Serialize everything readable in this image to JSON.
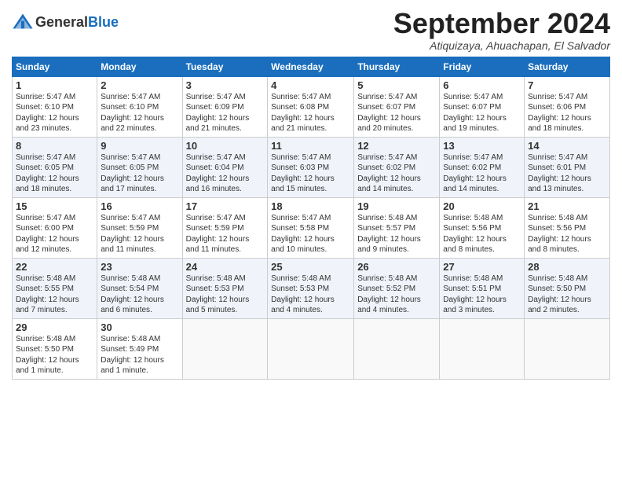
{
  "header": {
    "logo_text_general": "General",
    "logo_text_blue": "Blue",
    "month": "September 2024",
    "location": "Atiquizaya, Ahuachapan, El Salvador"
  },
  "columns": [
    "Sunday",
    "Monday",
    "Tuesday",
    "Wednesday",
    "Thursday",
    "Friday",
    "Saturday"
  ],
  "weeks": [
    [
      {
        "day": "1",
        "info": "Sunrise: 5:47 AM\nSunset: 6:10 PM\nDaylight: 12 hours\nand 23 minutes."
      },
      {
        "day": "2",
        "info": "Sunrise: 5:47 AM\nSunset: 6:10 PM\nDaylight: 12 hours\nand 22 minutes."
      },
      {
        "day": "3",
        "info": "Sunrise: 5:47 AM\nSunset: 6:09 PM\nDaylight: 12 hours\nand 21 minutes."
      },
      {
        "day": "4",
        "info": "Sunrise: 5:47 AM\nSunset: 6:08 PM\nDaylight: 12 hours\nand 21 minutes."
      },
      {
        "day": "5",
        "info": "Sunrise: 5:47 AM\nSunset: 6:07 PM\nDaylight: 12 hours\nand 20 minutes."
      },
      {
        "day": "6",
        "info": "Sunrise: 5:47 AM\nSunset: 6:07 PM\nDaylight: 12 hours\nand 19 minutes."
      },
      {
        "day": "7",
        "info": "Sunrise: 5:47 AM\nSunset: 6:06 PM\nDaylight: 12 hours\nand 18 minutes."
      }
    ],
    [
      {
        "day": "8",
        "info": "Sunrise: 5:47 AM\nSunset: 6:05 PM\nDaylight: 12 hours\nand 18 minutes."
      },
      {
        "day": "9",
        "info": "Sunrise: 5:47 AM\nSunset: 6:05 PM\nDaylight: 12 hours\nand 17 minutes."
      },
      {
        "day": "10",
        "info": "Sunrise: 5:47 AM\nSunset: 6:04 PM\nDaylight: 12 hours\nand 16 minutes."
      },
      {
        "day": "11",
        "info": "Sunrise: 5:47 AM\nSunset: 6:03 PM\nDaylight: 12 hours\nand 15 minutes."
      },
      {
        "day": "12",
        "info": "Sunrise: 5:47 AM\nSunset: 6:02 PM\nDaylight: 12 hours\nand 14 minutes."
      },
      {
        "day": "13",
        "info": "Sunrise: 5:47 AM\nSunset: 6:02 PM\nDaylight: 12 hours\nand 14 minutes."
      },
      {
        "day": "14",
        "info": "Sunrise: 5:47 AM\nSunset: 6:01 PM\nDaylight: 12 hours\nand 13 minutes."
      }
    ],
    [
      {
        "day": "15",
        "info": "Sunrise: 5:47 AM\nSunset: 6:00 PM\nDaylight: 12 hours\nand 12 minutes."
      },
      {
        "day": "16",
        "info": "Sunrise: 5:47 AM\nSunset: 5:59 PM\nDaylight: 12 hours\nand 11 minutes."
      },
      {
        "day": "17",
        "info": "Sunrise: 5:47 AM\nSunset: 5:59 PM\nDaylight: 12 hours\nand 11 minutes."
      },
      {
        "day": "18",
        "info": "Sunrise: 5:47 AM\nSunset: 5:58 PM\nDaylight: 12 hours\nand 10 minutes."
      },
      {
        "day": "19",
        "info": "Sunrise: 5:48 AM\nSunset: 5:57 PM\nDaylight: 12 hours\nand 9 minutes."
      },
      {
        "day": "20",
        "info": "Sunrise: 5:48 AM\nSunset: 5:56 PM\nDaylight: 12 hours\nand 8 minutes."
      },
      {
        "day": "21",
        "info": "Sunrise: 5:48 AM\nSunset: 5:56 PM\nDaylight: 12 hours\nand 8 minutes."
      }
    ],
    [
      {
        "day": "22",
        "info": "Sunrise: 5:48 AM\nSunset: 5:55 PM\nDaylight: 12 hours\nand 7 minutes."
      },
      {
        "day": "23",
        "info": "Sunrise: 5:48 AM\nSunset: 5:54 PM\nDaylight: 12 hours\nand 6 minutes."
      },
      {
        "day": "24",
        "info": "Sunrise: 5:48 AM\nSunset: 5:53 PM\nDaylight: 12 hours\nand 5 minutes."
      },
      {
        "day": "25",
        "info": "Sunrise: 5:48 AM\nSunset: 5:53 PM\nDaylight: 12 hours\nand 4 minutes."
      },
      {
        "day": "26",
        "info": "Sunrise: 5:48 AM\nSunset: 5:52 PM\nDaylight: 12 hours\nand 4 minutes."
      },
      {
        "day": "27",
        "info": "Sunrise: 5:48 AM\nSunset: 5:51 PM\nDaylight: 12 hours\nand 3 minutes."
      },
      {
        "day": "28",
        "info": "Sunrise: 5:48 AM\nSunset: 5:50 PM\nDaylight: 12 hours\nand 2 minutes."
      }
    ],
    [
      {
        "day": "29",
        "info": "Sunrise: 5:48 AM\nSunset: 5:50 PM\nDaylight: 12 hours\nand 1 minute."
      },
      {
        "day": "30",
        "info": "Sunrise: 5:48 AM\nSunset: 5:49 PM\nDaylight: 12 hours\nand 1 minute."
      },
      {
        "day": "",
        "info": ""
      },
      {
        "day": "",
        "info": ""
      },
      {
        "day": "",
        "info": ""
      },
      {
        "day": "",
        "info": ""
      },
      {
        "day": "",
        "info": ""
      }
    ]
  ]
}
